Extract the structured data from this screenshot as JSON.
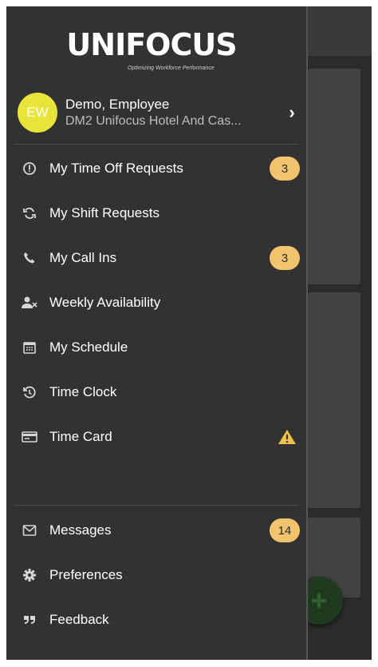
{
  "brand": {
    "name": "UNIFOCUS",
    "tagline": "Optimizing Workforce Performance"
  },
  "user": {
    "initials": "EW",
    "name": "Demo, Employee",
    "organization": "DM2 Unifocus Hotel And Cas..."
  },
  "menu": [
    {
      "label": "My Time Off Requests",
      "icon": "clock-alert-icon",
      "badge": "3"
    },
    {
      "label": "My Shift Requests",
      "icon": "swap-icon"
    },
    {
      "label": "My Call Ins",
      "icon": "phone-icon",
      "badge": "3"
    },
    {
      "label": "Weekly Availability",
      "icon": "user-availability-icon"
    },
    {
      "label": "My Schedule",
      "icon": "calendar-icon"
    },
    {
      "label": "Time Clock",
      "icon": "history-icon"
    },
    {
      "label": "Time Card",
      "icon": "card-icon",
      "alert": "warning-icon"
    }
  ],
  "footer_menu": [
    {
      "label": "Messages",
      "icon": "envelope-icon",
      "badge": "14"
    },
    {
      "label": "Preferences",
      "icon": "gear-icon"
    },
    {
      "label": "Feedback",
      "icon": "quote-icon"
    }
  ],
  "colors": {
    "drawer": "#323232",
    "badge": "#f2c46d",
    "avatar": "#e8e43a",
    "warning": "#f0c04a"
  }
}
